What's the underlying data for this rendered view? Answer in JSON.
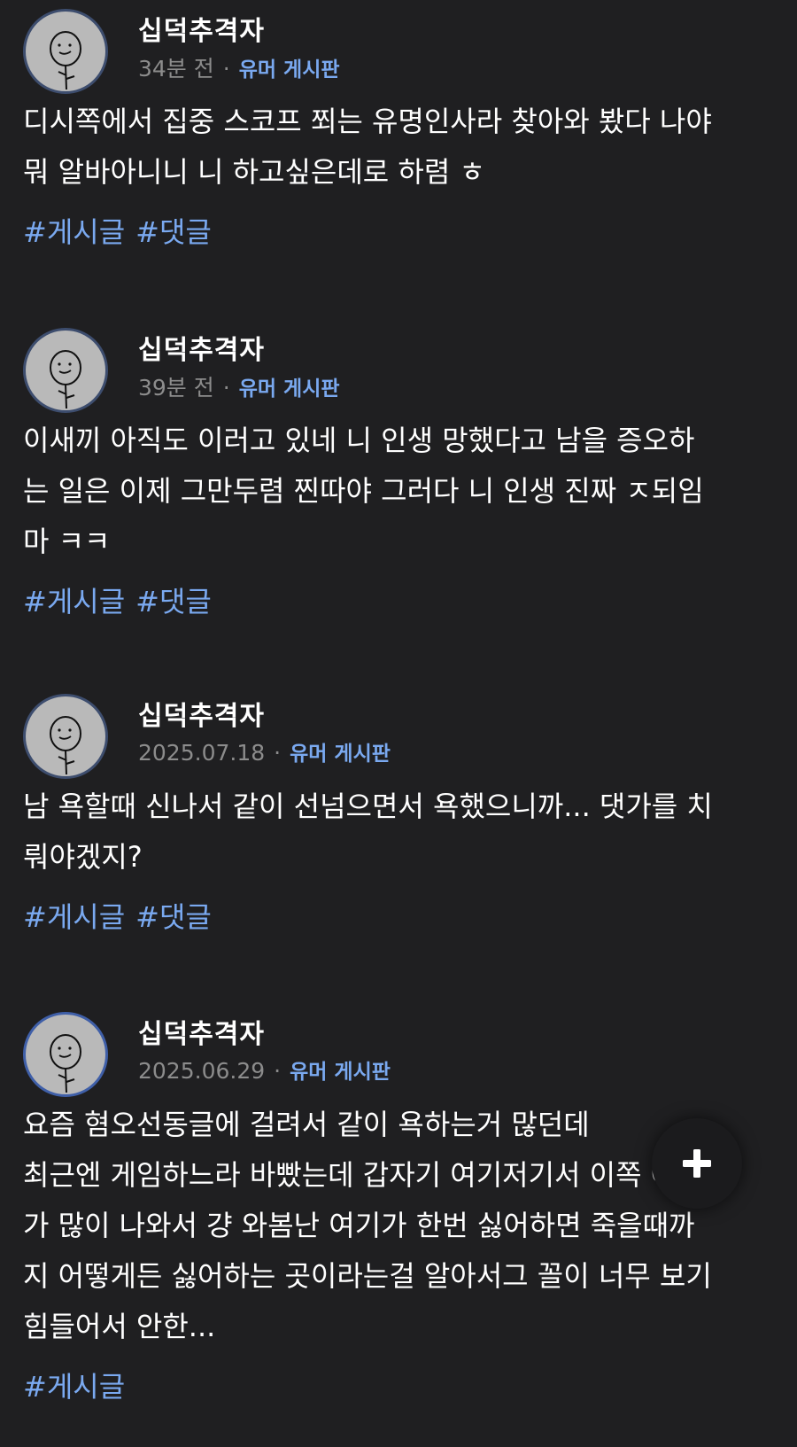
{
  "posts": [
    {
      "author": "십덕추격자",
      "time": "34분 전",
      "separator": "·",
      "board": "유머 게시판",
      "text": "디시쪽에서 집중 스코프 쬐는 유명인사라 찾아와 봤다 나야\n뭐 알바아니니 니 하고싶은데로 하렴 ㅎ",
      "tags": [
        "#게시글",
        "#댓글"
      ]
    },
    {
      "author": "십덕추격자",
      "time": "39분 전",
      "separator": "·",
      "board": "유머 게시판",
      "text": "이새끼 아직도 이러고 있네 니 인생 망했다고 남을 증오하\n는 일은 이제 그만두렴 찐따야 그러다 니 인생 진짜 ㅈ되임\n마 ㅋㅋ",
      "tags": [
        "#게시글",
        "#댓글"
      ]
    },
    {
      "author": "십덕추격자",
      "time": "2025.07.18",
      "separator": "·",
      "board": "유머 게시판",
      "text": "남 욕할때 신나서 같이 선넘으면서 욕했으니까... 댓가를 치\n뤄야겠지?",
      "tags": [
        "#게시글",
        "#댓글"
      ]
    },
    {
      "author": "십덕추격자",
      "time": "2025.06.29",
      "separator": "·",
      "board": "유머 게시판",
      "text": "요즘 혐오선동글에 걸려서 같이 욕하는거 많던데\n최근엔 게임하느라 바빴는데 갑자기 여기저기서 이쪽 얘기\n가 많이 나와서 걍 와봄난 여기가 한번 싫어하면 죽을때까\n지 어떻게든 싫어하는 곳이라는걸 알아서그 꼴이 너무 보기\n힘들어서 안한...",
      "tags": [
        "#게시글"
      ]
    }
  ],
  "fab": {
    "icon": "plus-icon"
  },
  "colors": {
    "background": "#1f1f21",
    "accent": "#7aa9f0",
    "meta": "#8c8c8c",
    "text": "#ffffff"
  }
}
